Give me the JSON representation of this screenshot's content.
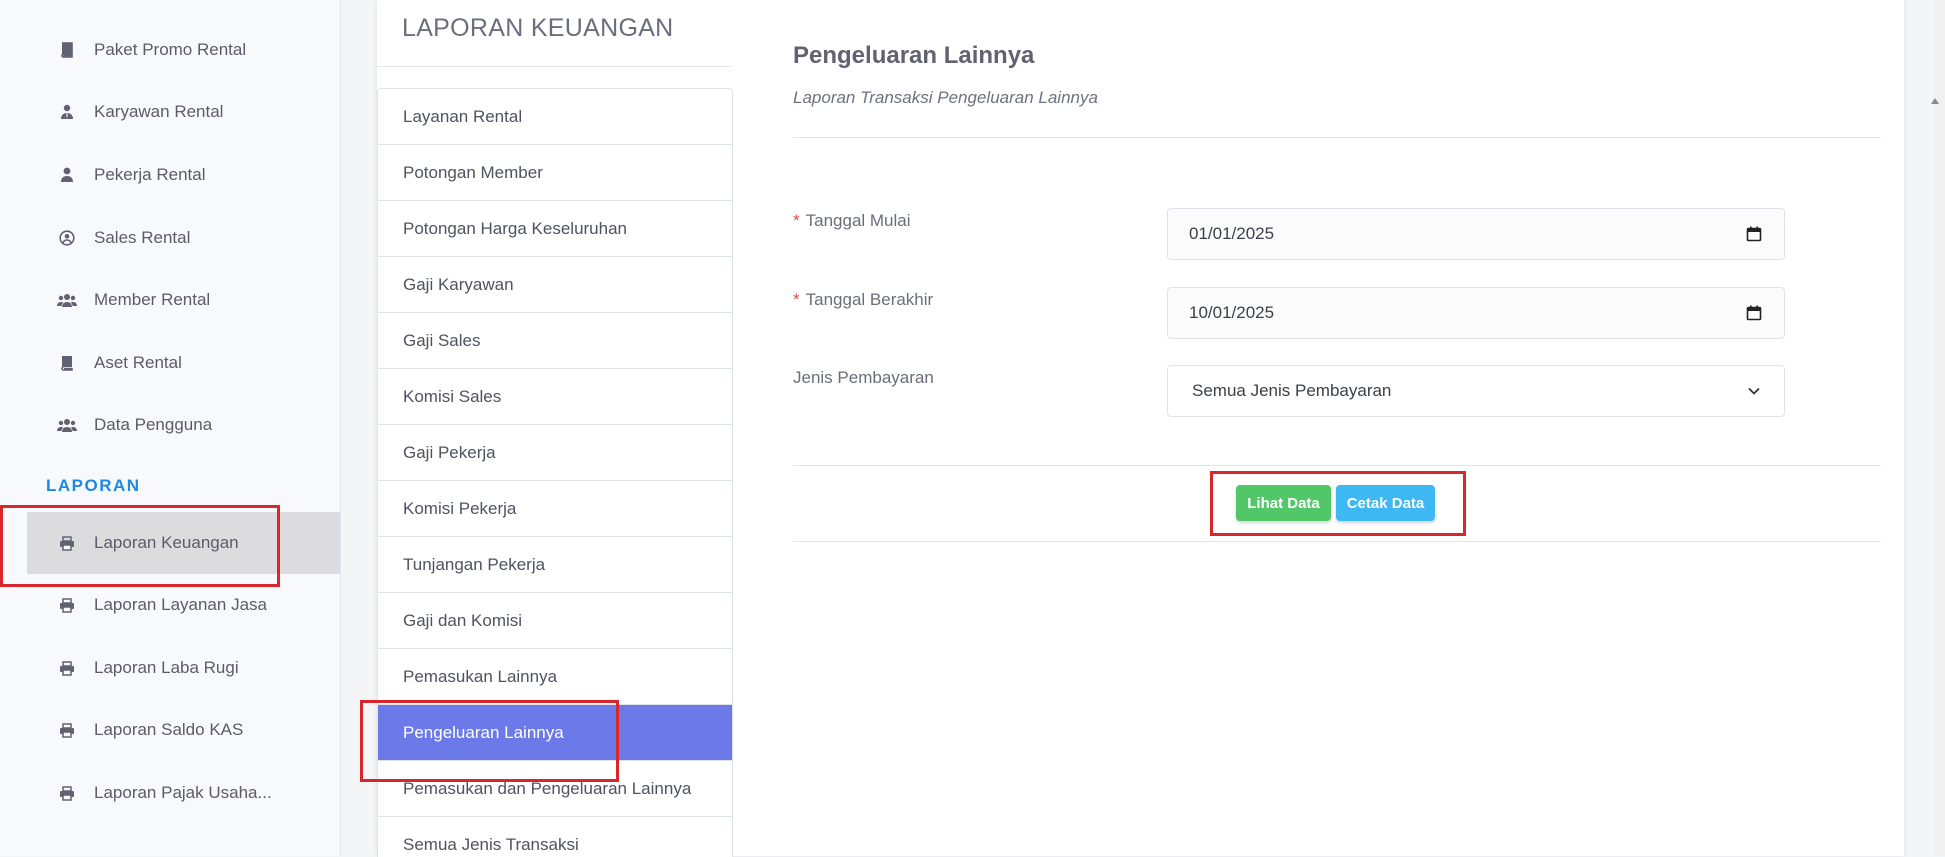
{
  "sidebar": {
    "items": [
      {
        "label": "Paket Promo Rental",
        "icon": "book-icon"
      },
      {
        "label": "Karyawan Rental",
        "icon": "user-tie-icon"
      },
      {
        "label": "Pekerja Rental",
        "icon": "user-icon"
      },
      {
        "label": "Sales Rental",
        "icon": "user-circle-icon"
      },
      {
        "label": "Member Rental",
        "icon": "users-icon"
      },
      {
        "label": "Aset Rental",
        "icon": "book-icon"
      },
      {
        "label": "Data Pengguna",
        "icon": "users-icon"
      }
    ],
    "section_heading": "LAPORAN",
    "report_items": [
      {
        "label": "Laporan Keuangan",
        "icon": "print-icon",
        "active": true
      },
      {
        "label": "Laporan Layanan Jasa",
        "icon": "print-icon"
      },
      {
        "label": "Laporan Laba Rugi",
        "icon": "print-icon"
      },
      {
        "label": "Laporan Saldo KAS",
        "icon": "print-icon"
      },
      {
        "label": "Laporan Pajak Usaha...",
        "icon": "print-icon"
      }
    ]
  },
  "report_panel": {
    "title": "LAPORAN KEUANGAN",
    "items": [
      "Layanan Rental",
      "Potongan Member",
      "Potongan Harga Keseluruhan",
      "Gaji Karyawan",
      "Gaji Sales",
      "Komisi Sales",
      "Gaji Pekerja",
      "Komisi Pekerja",
      "Tunjangan Pekerja",
      "Gaji dan Komisi",
      "Pemasukan Lainnya",
      "Pengeluaran Lainnya",
      "Pemasukan dan Pengeluaran Lainnya",
      "Semua Jenis Transaksi"
    ],
    "active_index": 11
  },
  "form": {
    "title": "Pengeluaran Lainnya",
    "subtitle": "Laporan Transaksi Pengeluaran Lainnya",
    "required_mark": "*",
    "start_date": {
      "label": "Tanggal Mulai",
      "value": "01/01/2025"
    },
    "end_date": {
      "label": "Tanggal Berakhir",
      "value": "10/01/2025"
    },
    "payment_type": {
      "label": "Jenis Pembayaran",
      "value": "Semua Jenis Pembayaran"
    },
    "view_button": "Lihat Data",
    "print_button": "Cetak Data"
  },
  "colors": {
    "active_item": "#6b7ae8",
    "view_button": "#52c76a",
    "print_button": "#3db8f2",
    "section_heading": "#1e88e5",
    "highlight": "#d9262b"
  }
}
